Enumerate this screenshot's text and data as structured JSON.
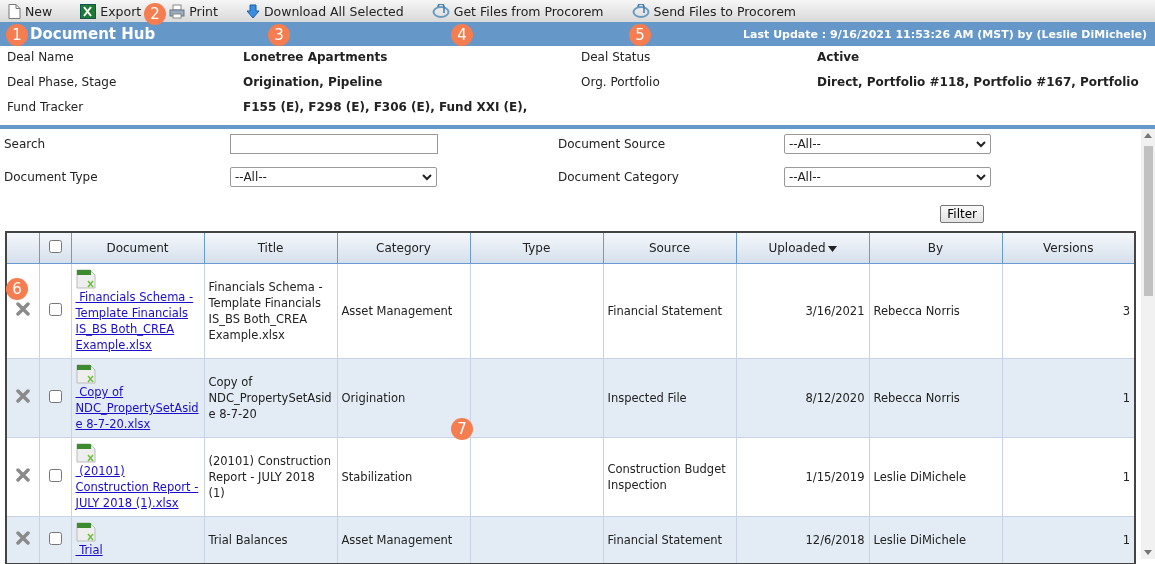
{
  "toolbar": [
    {
      "label": "New",
      "kind": "new"
    },
    {
      "label": "Export",
      "kind": "export"
    },
    {
      "label": "Print",
      "kind": "print"
    },
    {
      "label": "Download All Selected",
      "kind": "download"
    },
    {
      "label": "Get Files from Procorem",
      "kind": "procorem"
    },
    {
      "label": "Send Files to Procorem",
      "kind": "procorem"
    }
  ],
  "header": {
    "title": "Document Hub",
    "last_update": "Last Update : 9/16/2021 11:53:26 AM (MST) by (Leslie DiMichele)"
  },
  "details": [
    [
      {
        "label": "Deal Name",
        "value": "Lonetree Apartments"
      },
      {
        "label": "Deal Status",
        "value": "Active"
      }
    ],
    [
      {
        "label": "Deal Phase, Stage",
        "value": "Origination, Pipeline"
      },
      {
        "label": "Org. Portfolio",
        "value": "Direct, Portfolio #118, Portfolio #167, Portfolio"
      }
    ],
    [
      {
        "label": "Fund Tracker",
        "value": "F155 (E), F298 (E), F306 (E), Fund XXI (E),"
      }
    ]
  ],
  "filters": [
    {
      "label": "Search",
      "kind": "text"
    },
    {
      "label": "Document Source",
      "kind": "select",
      "value": "--All--"
    },
    {
      "label": "Document Type",
      "kind": "select",
      "value": "--All--"
    },
    {
      "label": "Document Category",
      "kind": "select",
      "value": "--All--"
    }
  ],
  "filter_button": "Filter",
  "table": {
    "select_all": {
      "checked": false
    },
    "columns": [
      {
        "label": "Document",
        "sorted": false
      },
      {
        "label": "Title",
        "sorted": false
      },
      {
        "label": "Category",
        "sorted": false
      },
      {
        "label": "Type",
        "sorted": false
      },
      {
        "label": "Source",
        "sorted": false
      },
      {
        "label": "Uploaded",
        "sorted": true
      },
      {
        "label": "By",
        "sorted": false
      },
      {
        "label": "Versions",
        "sorted": false
      }
    ],
    "rows": [
      {
        "checked": false,
        "document": "Financials Schema - Template Financials IS_BS Both_CREA Example.xlsx",
        "title": "Financials Schema - Template Financials IS_BS Both_CREA Example.xlsx",
        "category": "Asset Management",
        "source": "Financial Statement",
        "uploaded": "3/16/2021",
        "by": "Rebecca Norris",
        "versions": "3"
      },
      {
        "checked": false,
        "document": "Copy of NDC_PropertySetAside 8-7-20.xlsx",
        "title": "Copy of NDC_PropertySetAside 8-7-20",
        "category": "Origination",
        "source": "Inspected File",
        "uploaded": "8/12/2020",
        "by": "Rebecca Norris",
        "versions": "1"
      },
      {
        "checked": false,
        "document": "(20101) Construction Report - JULY 2018 (1).xlsx",
        "title": "(20101) Construction Report - JULY 2018 (1)",
        "category": "Stabilization",
        "source": "Construction Budget Inspection",
        "uploaded": "1/15/2019",
        "by": "Leslie DiMichele",
        "versions": "1"
      },
      {
        "checked": false,
        "document": "Trial",
        "title": "Trial Balances",
        "category": "Asset Management",
        "source": "Financial Statement",
        "uploaded": "12/6/2018",
        "by": "Leslie DiMichele",
        "versions": "1"
      }
    ]
  },
  "callouts": [
    "1",
    "2",
    "3",
    "4",
    "5",
    "6",
    "7"
  ]
}
